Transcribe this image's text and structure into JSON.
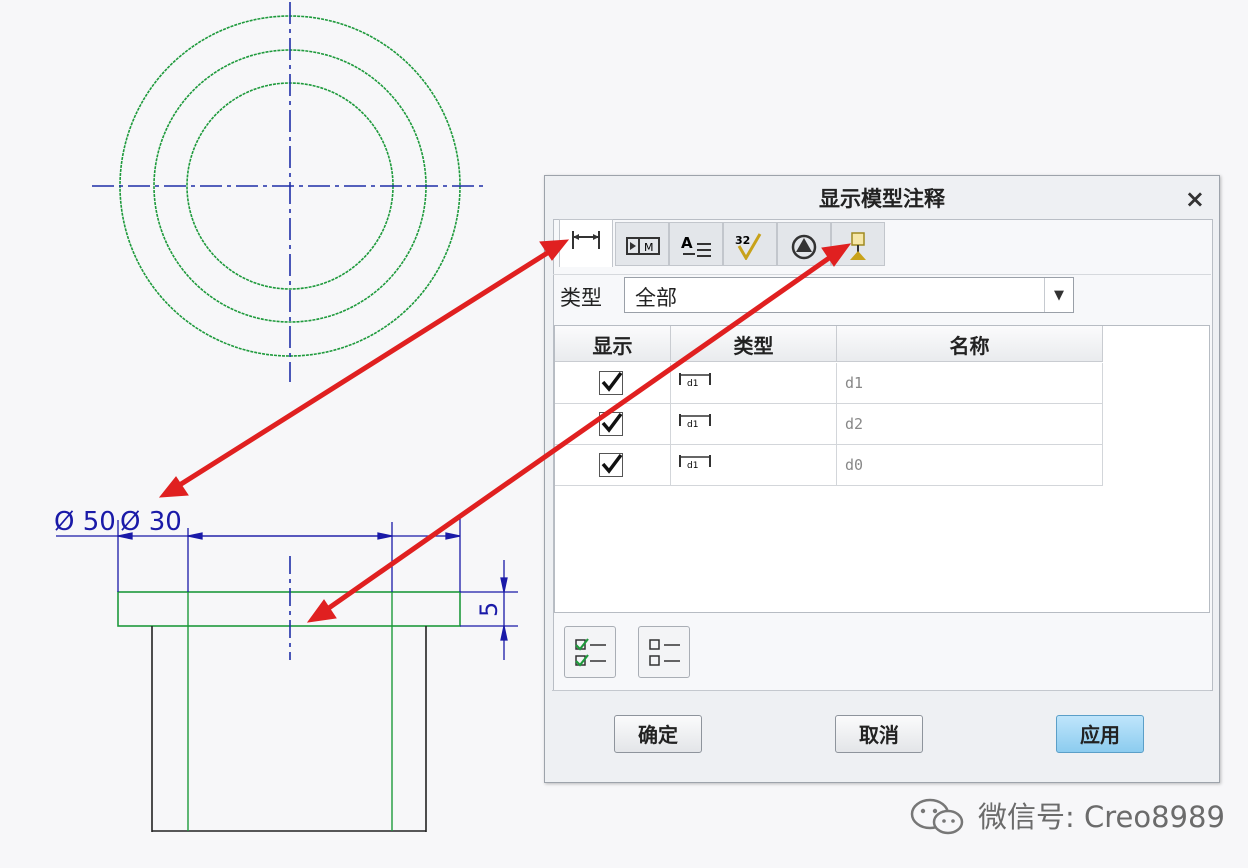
{
  "drawing": {
    "dim_dia_outer": "Ø 50",
    "dim_dia_inner": "Ø 30",
    "dim_height": "5"
  },
  "dialog": {
    "title": "显示模型注释",
    "close": "×",
    "tabs": [
      {
        "icon": "dimension-tab-icon",
        "active": true
      },
      {
        "icon": "gtol-tab-icon",
        "active": false
      },
      {
        "icon": "note-tab-icon",
        "active": false
      },
      {
        "icon": "surface-finish-tab-icon",
        "active": false
      },
      {
        "icon": "symbol-tab-icon",
        "active": false
      },
      {
        "icon": "datum-tab-icon",
        "active": false
      }
    ],
    "type_label": "类型",
    "type_value": "全部",
    "table": {
      "headers": [
        "显示",
        "类型",
        "名称"
      ],
      "rows": [
        {
          "checked": true,
          "type_icon": "dimension-type-icon",
          "name": "d1"
        },
        {
          "checked": true,
          "type_icon": "dimension-type-icon",
          "name": "d2"
        },
        {
          "checked": true,
          "type_icon": "dimension-type-icon",
          "name": "d0"
        }
      ]
    },
    "select_all_icon": "select-all-icon",
    "deselect_all_icon": "deselect-all-icon",
    "buttons": {
      "ok": "确定",
      "cancel": "取消",
      "apply": "应用"
    }
  },
  "watermark": "微信号: Creo8989",
  "colors": {
    "geometry": "#1e9a3c",
    "centerline": "#1f2fa8",
    "dimension": "#1a1aa8",
    "arrow": "#e02020",
    "apply": "#9fd6f5"
  }
}
